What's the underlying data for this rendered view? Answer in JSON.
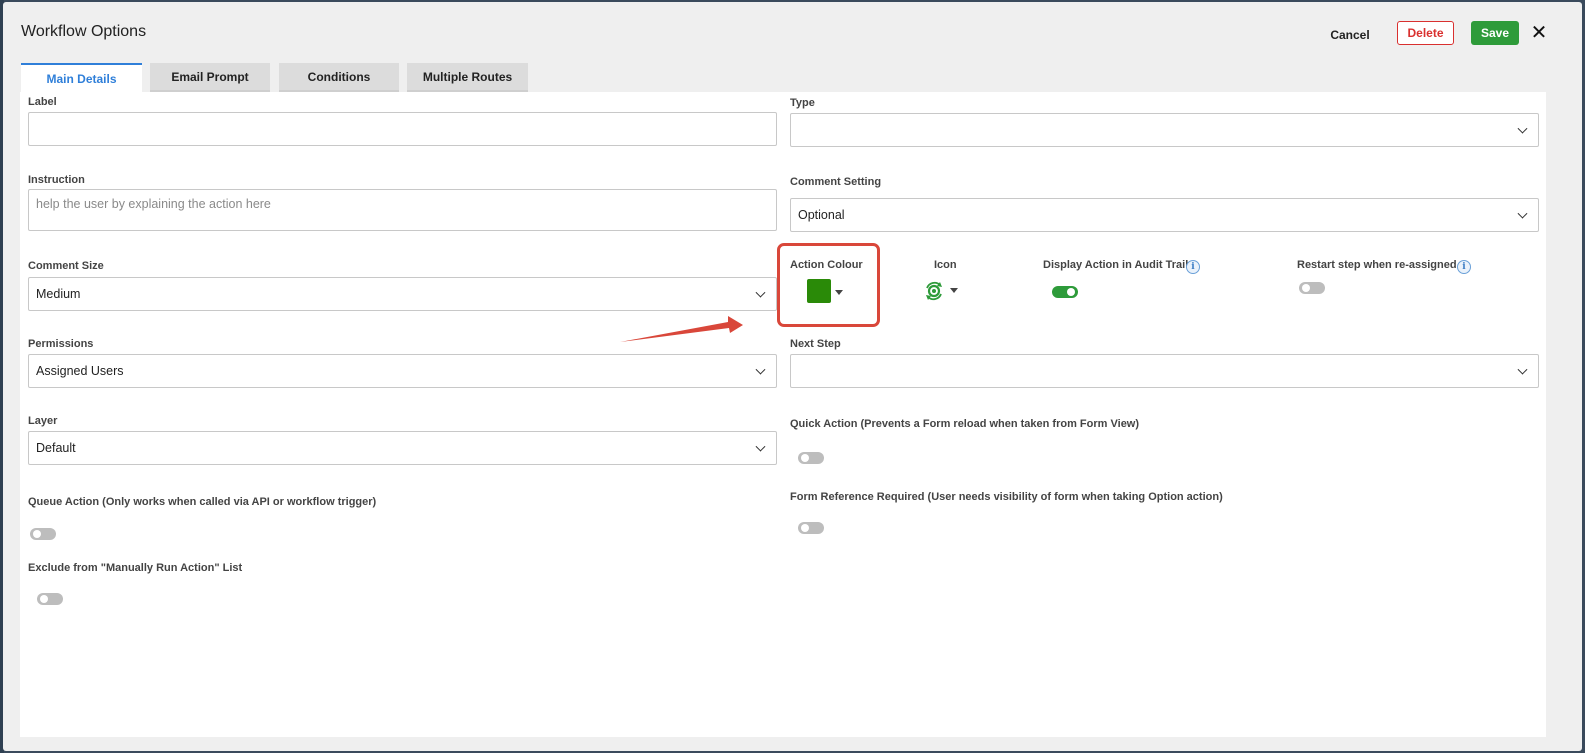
{
  "dialog": {
    "title": "Workflow Options",
    "cancel_label": "Cancel",
    "delete_label": "Delete",
    "save_label": "Save",
    "close_glyph": "✕"
  },
  "tabs": [
    {
      "label": "Main Details",
      "active": true
    },
    {
      "label": "Email Prompt",
      "active": false
    },
    {
      "label": "Conditions",
      "active": false
    },
    {
      "label": "Multiple Routes",
      "active": false
    }
  ],
  "form": {
    "label": {
      "label": "Label",
      "value": ""
    },
    "type": {
      "label": "Type",
      "value": ""
    },
    "instruction": {
      "label": "Instruction",
      "value": "",
      "placeholder": "help the user by explaining the action here"
    },
    "comment_setting": {
      "label": "Comment Setting",
      "value": "Optional"
    },
    "comment_size": {
      "label": "Comment Size",
      "value": "Medium"
    },
    "action_colour": {
      "label": "Action Colour",
      "color": "#2a8a08"
    },
    "icon": {
      "label": "Icon",
      "icon_name": "refresh-gear-icon"
    },
    "display_in_audit": {
      "label": "Display Action in Audit Trail",
      "on": true,
      "info_glyph": "i"
    },
    "restart_step": {
      "label": "Restart step when re-assigned",
      "on": false,
      "info_glyph": "i"
    },
    "permissions": {
      "label": "Permissions",
      "value": "Assigned Users"
    },
    "next_step": {
      "label": "Next Step",
      "value": ""
    },
    "layer": {
      "label": "Layer",
      "value": "Default"
    },
    "quick_action": {
      "label": "Quick Action (Prevents a Form reload when taken from Form View)",
      "on": false
    },
    "queue_action": {
      "label": "Queue Action (Only works when called via API or workflow trigger)",
      "on": false
    },
    "form_reference_required": {
      "label": "Form Reference Required (User needs visibility of form when taking Option action)",
      "on": false
    },
    "exclude_manual": {
      "label": "Exclude from \"Manually Run Action\" List",
      "on": false
    }
  },
  "colors": {
    "accent": "#2f7fd9",
    "save": "#2e9b3a",
    "delete": "#d9302f",
    "annotation": "#d9473a"
  }
}
